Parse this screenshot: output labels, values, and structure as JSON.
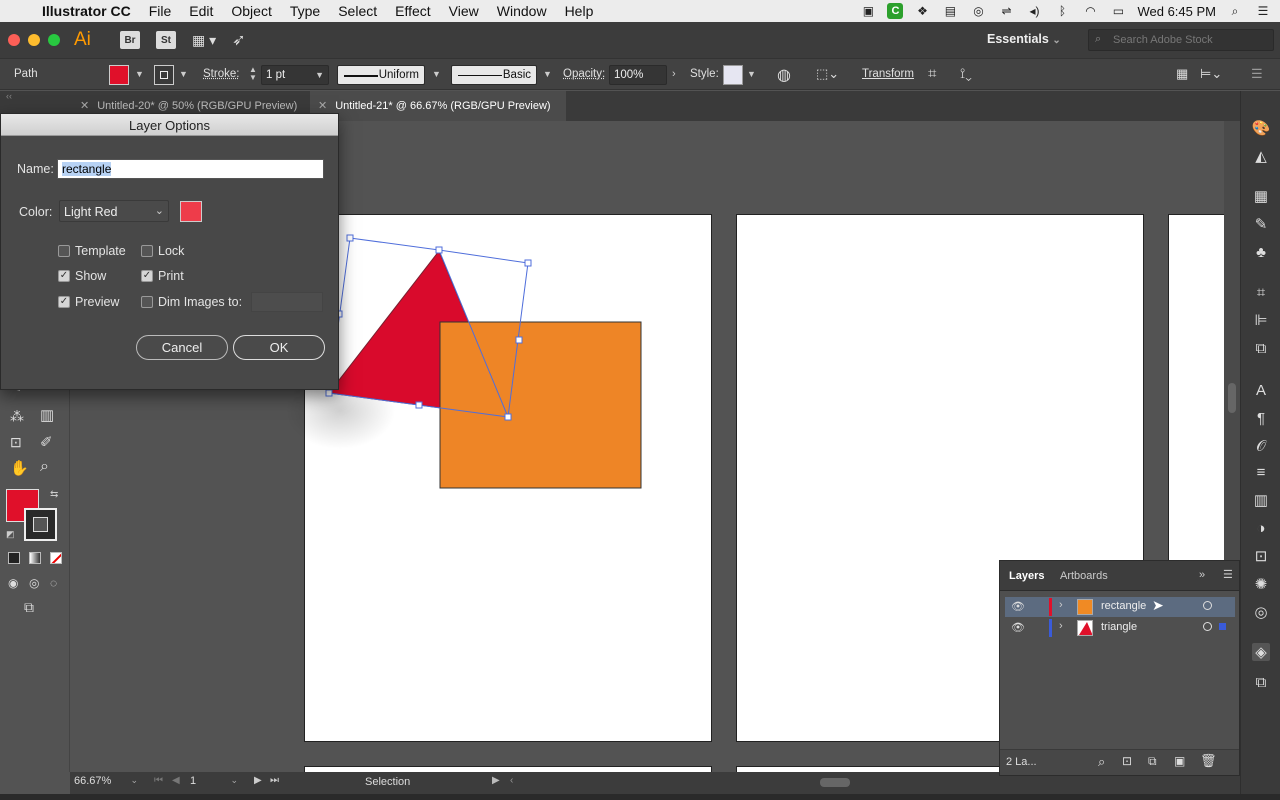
{
  "menubar": {
    "app_name": "Illustrator CC",
    "items": [
      "File",
      "Edit",
      "Object",
      "Type",
      "Select",
      "Effect",
      "View",
      "Window",
      "Help"
    ],
    "clock": "Wed 6:45 PM"
  },
  "appbar": {
    "logo": "Ai",
    "bridge": "Br",
    "stock": "St",
    "workspace": "Essentials",
    "search_placeholder": "Search Adobe Stock"
  },
  "controlbar": {
    "selection_type": "Path",
    "stroke_label": "Stroke:",
    "stroke_weight": "1 pt",
    "profile": "Uniform",
    "brush": "Basic",
    "opacity_label": "Opacity:",
    "opacity": "100%",
    "style_label": "Style:",
    "transform": "Transform",
    "fill_color": "#e0102a"
  },
  "tabs": [
    {
      "label": "Untitled-20* @ 50% (RGB/GPU Preview)",
      "active": false
    },
    {
      "label": "Untitled-21* @ 66.67% (RGB/GPU Preview)",
      "active": true
    }
  ],
  "dialog": {
    "title": "Layer Options",
    "name_label": "Name:",
    "name_value": "rectangle",
    "color_label": "Color:",
    "color_value": "Light Red",
    "color_swatch": "#ee3c4a",
    "checkboxes": {
      "template": {
        "label": "Template",
        "checked": false
      },
      "lock": {
        "label": "Lock",
        "checked": false
      },
      "show": {
        "label": "Show",
        "checked": true
      },
      "print": {
        "label": "Print",
        "checked": true
      },
      "preview": {
        "label": "Preview",
        "checked": true
      },
      "dim": {
        "label": "Dim Images to:",
        "checked": false
      }
    },
    "cancel": "Cancel",
    "ok": "OK"
  },
  "layers_panel": {
    "tab_layers": "Layers",
    "tab_artboards": "Artboards",
    "layers": [
      {
        "name": "rectangle",
        "color": "#e0102a",
        "thumb": "#f08a24",
        "selected": true
      },
      {
        "name": "triangle",
        "color": "#3a5bd9",
        "thumb": "#e0102a",
        "selected": false
      }
    ],
    "count": "2 La..."
  },
  "statusbar": {
    "zoom": "66.67%",
    "artboard": "1",
    "tool": "Selection"
  },
  "colors": {
    "triangle_fill": "#d90a2c",
    "rectangle_fill": "#ee8526",
    "selection": "#4f6edb"
  }
}
